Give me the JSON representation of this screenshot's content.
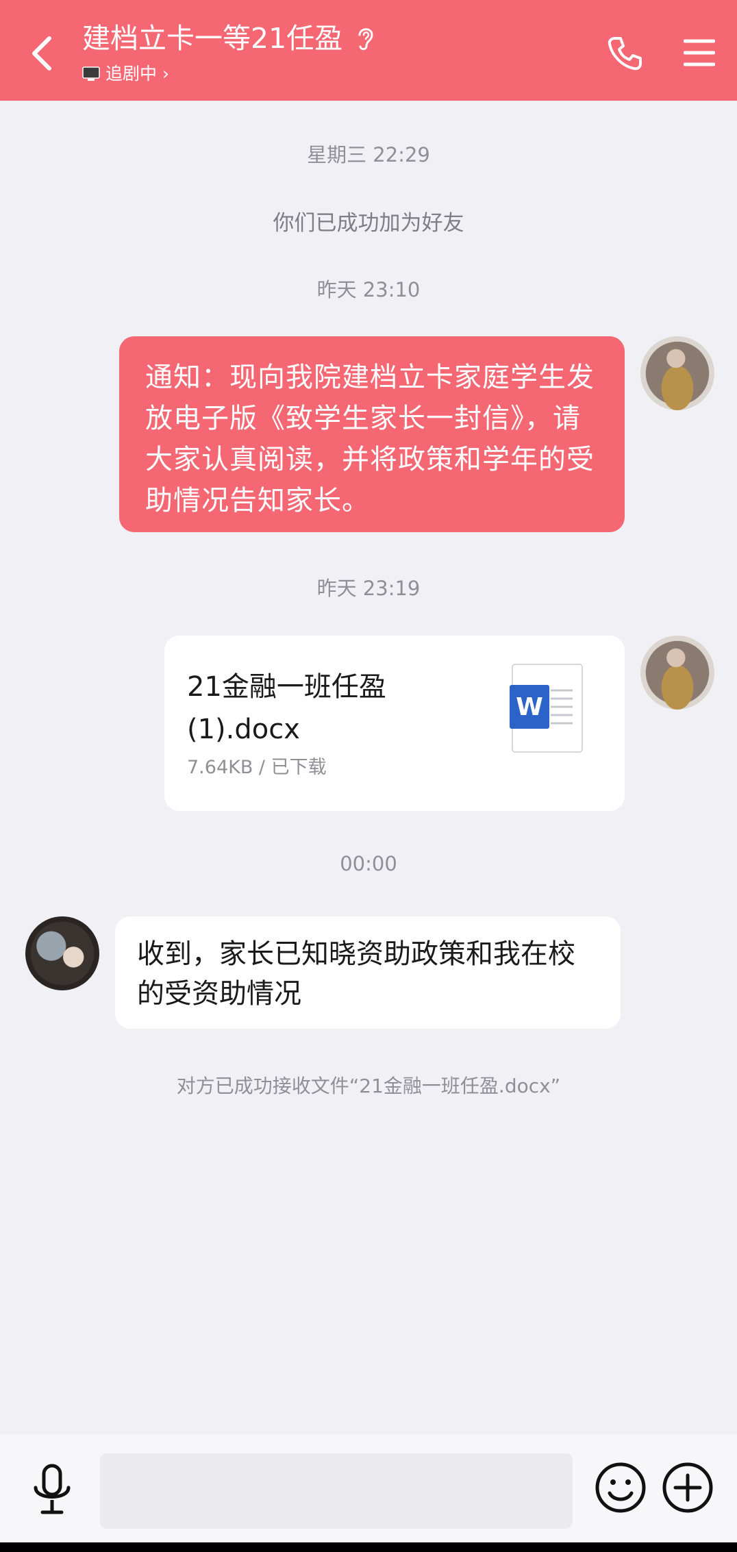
{
  "header": {
    "title": "建档立卡一等21任盈",
    "status": "追剧中",
    "status_chevron": "›",
    "background_color": "#F56773"
  },
  "messages": {
    "time1": "星期三 22:29",
    "system_friend": "你们已成功加为好友",
    "time2": "昨天 23:10",
    "notice_text": " 通知：现向我院建档立卡家庭学生发放电子版《致学生家长一封信》，请大家认真阅读，并将政策和学年的受助情况告知家长。",
    "time3": "昨天 23:19",
    "file": {
      "name": "21金融一班任盈(1).docx",
      "meta": "7.64KB / 已下载",
      "icon": "word-doc-icon"
    },
    "time4": "00:00",
    "reply_text": "收到，家长已知晓资助政策和我在校的受资助情况",
    "system_file_received": "对方已成功接收文件“21金融一班任盈.docx”"
  },
  "input": {
    "value": "",
    "placeholder": ""
  },
  "icons": {
    "back": "chevron-left-icon",
    "ear": "ear-icon",
    "tv": "tv-icon",
    "phone": "phone-icon",
    "menu": "menu-icon",
    "mic": "microphone-icon",
    "emoji": "emoji-icon",
    "plus": "plus-icon"
  },
  "colors": {
    "accent": "#F56773",
    "background": "#F0F0F5",
    "meta_text": "#8f8f95",
    "word_blue": "#2B63C8"
  }
}
